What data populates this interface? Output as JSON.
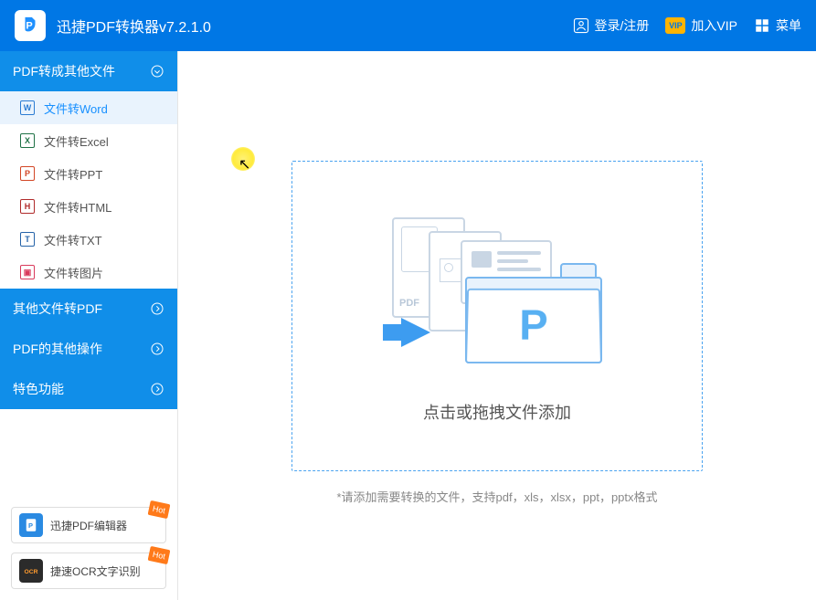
{
  "titlebar": {
    "app_title": "迅捷PDF转换器v7.2.1.0",
    "login": "登录/注册",
    "vip_badge": "VIP",
    "vip": "加入VIP",
    "menu": "菜单"
  },
  "sidebar": {
    "sections": [
      {
        "label": "PDF转成其他文件",
        "expanded": true
      },
      {
        "label": "其他文件转PDF",
        "expanded": false
      },
      {
        "label": "PDF的其他操作",
        "expanded": false
      },
      {
        "label": "特色功能",
        "expanded": false
      }
    ],
    "items": [
      {
        "label": "文件转Word",
        "icon": "W",
        "active": true
      },
      {
        "label": "文件转Excel",
        "icon": "X",
        "active": false
      },
      {
        "label": "文件转PPT",
        "icon": "P",
        "active": false
      },
      {
        "label": "文件转HTML",
        "icon": "H",
        "active": false
      },
      {
        "label": "文件转TXT",
        "icon": "T",
        "active": false
      },
      {
        "label": "文件转图片",
        "icon": "▣",
        "active": false
      }
    ],
    "promos": [
      {
        "label": "迅捷PDF编辑器",
        "badge": "Hot"
      },
      {
        "label": "捷速OCR文字识别",
        "badge": "Hot"
      }
    ]
  },
  "main": {
    "dropzone_text": "点击或拖拽文件添加",
    "hint": "*请添加需要转换的文件，支持pdf，xls，xlsx，ppt，pptx格式",
    "pdf_label": "PDF"
  },
  "colors": {
    "primary": "#108ee9",
    "titlebar": "#0077e5",
    "accent": "#1890ff"
  }
}
